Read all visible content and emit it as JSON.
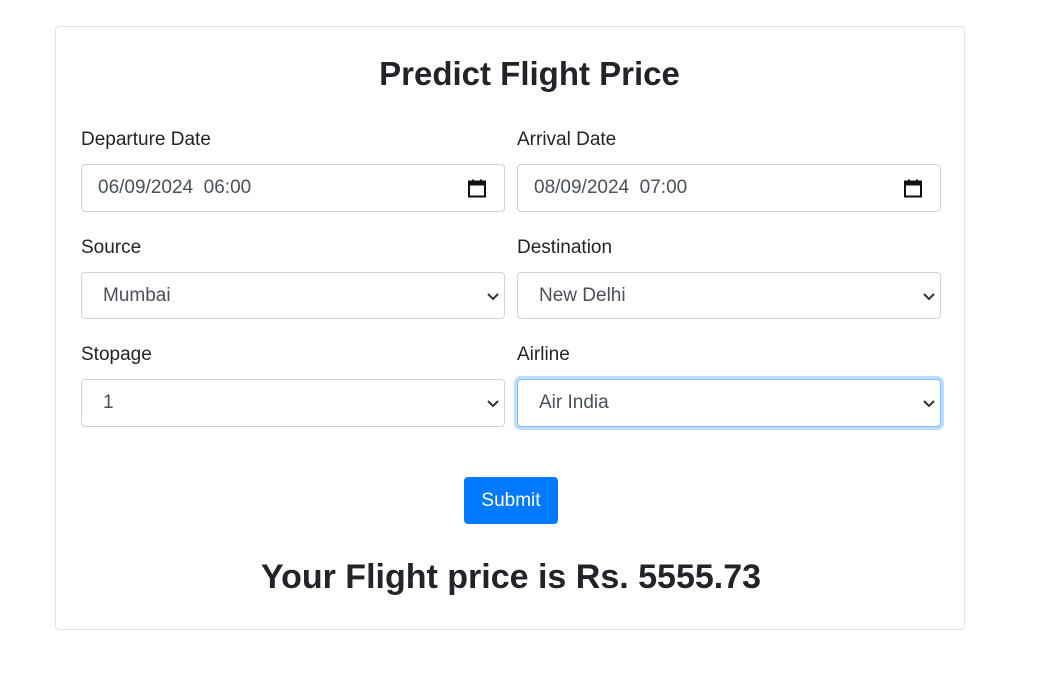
{
  "form": {
    "title": "Predict Flight Price",
    "departure": {
      "label": "Departure Date",
      "value": "06/09/2024  06:00",
      "icon": "calendar-icon"
    },
    "arrival": {
      "label": "Arrival Date",
      "value": "08/09/2024  07:00",
      "icon": "calendar-icon"
    },
    "source": {
      "label": "Source",
      "selected": "Mumbai"
    },
    "destination": {
      "label": "Destination",
      "selected": "New Delhi"
    },
    "stopage": {
      "label": "Stopage",
      "selected": "1"
    },
    "airline": {
      "label": "Airline",
      "selected": "Air India"
    },
    "submit_label": "Submit"
  },
  "result": {
    "text": "Your Flight price is Rs. 5555.73"
  },
  "colors": {
    "primary": "#007bff",
    "focus_border": "#80bdff",
    "text": "#212529"
  }
}
